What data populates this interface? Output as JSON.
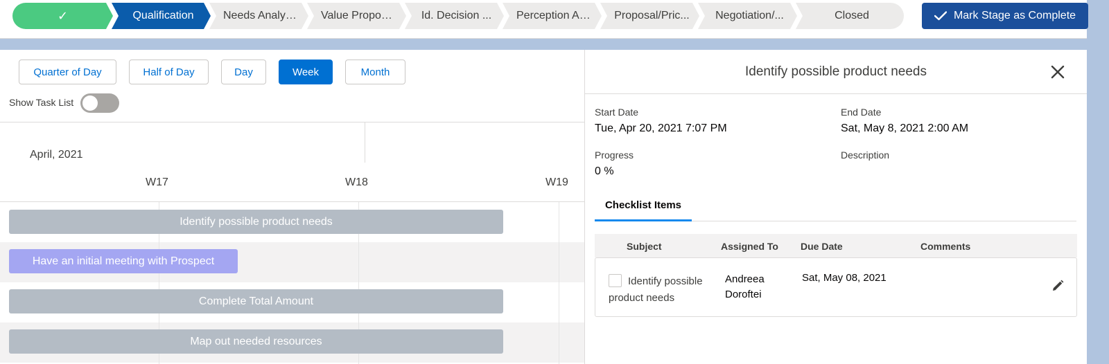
{
  "path": {
    "stages": [
      {
        "label": "✓",
        "state": "complete"
      },
      {
        "label": "Qualification",
        "state": "current"
      },
      {
        "label": "Needs Analysis",
        "state": "incomplete"
      },
      {
        "label": "Value Proposi...",
        "state": "incomplete"
      },
      {
        "label": "Id. Decision ...",
        "state": "incomplete"
      },
      {
        "label": "Perception An...",
        "state": "incomplete"
      },
      {
        "label": "Proposal/Pric...",
        "state": "incomplete"
      },
      {
        "label": "Negotiation/...",
        "state": "incomplete"
      },
      {
        "label": "Closed",
        "state": "incomplete"
      }
    ],
    "mark_complete_label": "Mark Stage as Complete"
  },
  "gantt": {
    "zoom_buttons": [
      {
        "label": "Quarter of Day",
        "active": false
      },
      {
        "label": "Half of Day",
        "active": false
      },
      {
        "label": "Day",
        "active": false
      },
      {
        "label": "Week",
        "active": true
      },
      {
        "label": "Month",
        "active": false
      }
    ],
    "show_task_list_label": "Show Task List",
    "show_task_list_on": false,
    "month_label": "April, 2021",
    "weeks": [
      "W17",
      "W18",
      "W19"
    ],
    "tasks": [
      {
        "name": "Identify possible product needs",
        "color": "#b4bcc5"
      },
      {
        "name": "Have an initial meeting with Prospect",
        "color": "#a4a6f2"
      },
      {
        "name": "Complete Total Amount",
        "color": "#b4bcc5"
      },
      {
        "name": "Map out needed resources",
        "color": "#b4bcc5"
      }
    ]
  },
  "panel": {
    "title": "Identify possible product needs",
    "start_date_label": "Start Date",
    "start_date": "Tue, Apr 20, 2021 7:07 PM",
    "end_date_label": "End Date",
    "end_date": "Sat, May 8, 2021 2:00 AM",
    "progress_label": "Progress",
    "progress": "0 %",
    "description_label": "Description",
    "tab_label": "Checklist Items",
    "checklist": {
      "columns": [
        "Subject",
        "Assigned To",
        "Due Date",
        "Comments"
      ],
      "rows": [
        {
          "subject": "Identify possible product needs",
          "assigned_to": "Andreea Doroftei",
          "due_date": "Sat, May 08, 2021",
          "comments": "",
          "checked": false
        }
      ]
    }
  },
  "colors": {
    "primary": "#0070d2",
    "path_current": "#0b5cab",
    "path_complete": "#4bca81",
    "mark_button": "#1b4f9b"
  }
}
